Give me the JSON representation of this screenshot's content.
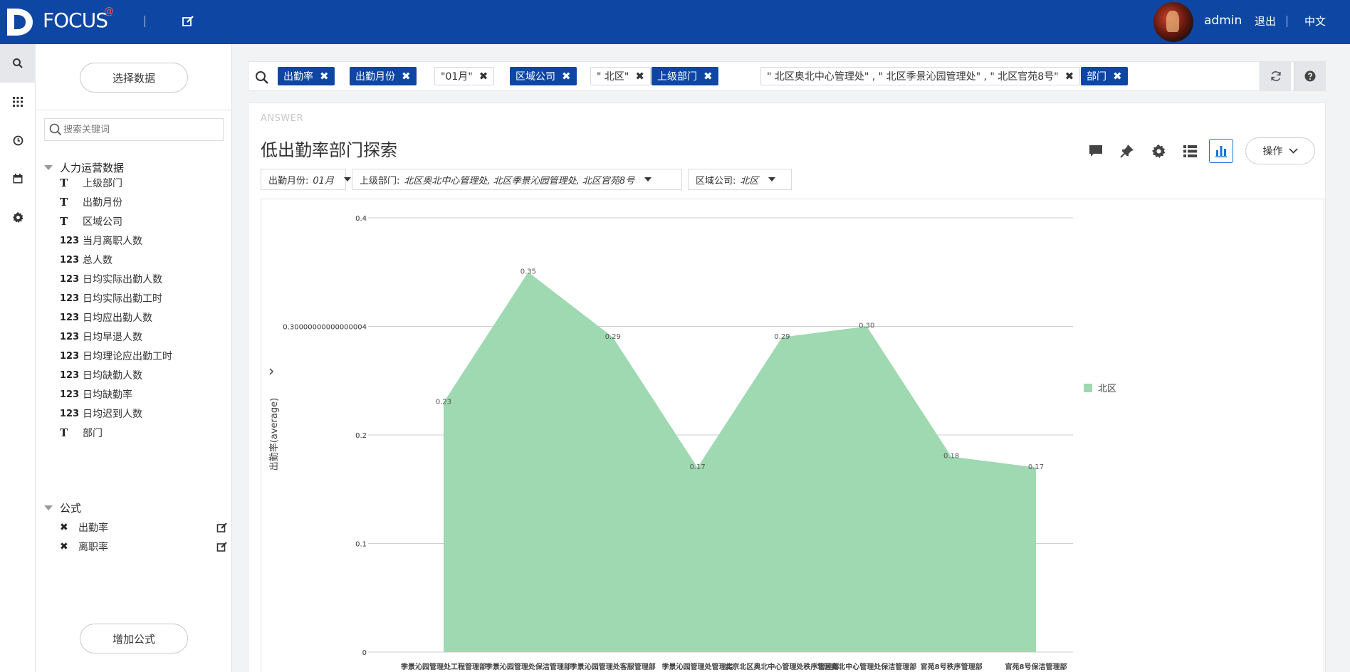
{
  "header": {
    "logo_text": "FOCUS",
    "logo_mark": "@",
    "user": "admin",
    "logout": "退出",
    "language": "中文"
  },
  "rail": {
    "items": [
      {
        "icon": "search-icon",
        "active": true
      },
      {
        "icon": "grid-icon",
        "active": false
      },
      {
        "icon": "clock-icon",
        "active": false
      },
      {
        "icon": "calendar-icon",
        "active": false
      },
      {
        "icon": "gear-icon",
        "active": false
      }
    ]
  },
  "panel": {
    "select_data": "选择数据",
    "search_placeholder": "搜索关键词",
    "group_title": "人力运营数据",
    "fields": [
      {
        "type": "T",
        "name": "上级部门"
      },
      {
        "type": "T",
        "name": "出勤月份"
      },
      {
        "type": "T",
        "name": "区域公司"
      },
      {
        "type": "123",
        "name": "当月离职人数"
      },
      {
        "type": "123",
        "name": "总人数"
      },
      {
        "type": "123",
        "name": "日均实际出勤人数"
      },
      {
        "type": "123",
        "name": "日均实际出勤工时"
      },
      {
        "type": "123",
        "name": "日均应出勤人数"
      },
      {
        "type": "123",
        "name": "日均早退人数"
      },
      {
        "type": "123",
        "name": "日均理论应出勤工时"
      },
      {
        "type": "123",
        "name": "日均缺勤人数"
      },
      {
        "type": "123",
        "name": "日均缺勤率"
      },
      {
        "type": "123",
        "name": "日均迟到人数"
      },
      {
        "type": "T",
        "name": "部门"
      }
    ],
    "formula_title": "公式",
    "formulas": [
      "出勤率",
      "离职率"
    ],
    "add_formula": "增加公式"
  },
  "tags": [
    {
      "label": "出勤率",
      "style": "blue"
    },
    {
      "label": "出勤月份",
      "style": "blue"
    },
    {
      "label": "\"01月\"",
      "style": "plain"
    },
    {
      "label": "区域公司",
      "style": "blue"
    },
    {
      "label": "\" 北区\"",
      "style": "plain"
    },
    {
      "label": "上级部门",
      "style": "blue"
    },
    {
      "label": "\" 北区奥北中心管理处\" , \" 北区季景沁园管理处\" , \" 北区官苑8号\"",
      "style": "plain"
    },
    {
      "label": "部门",
      "style": "blue"
    }
  ],
  "answer": {
    "label": "ANSWER",
    "title": "低出勤率部门探索",
    "ops": "操作",
    "filters": [
      {
        "key": "出勤月份:",
        "value": "01月"
      },
      {
        "key": "上级部门:",
        "value": "北区奥北中心管理处, 北区季景沁园管理处, 北区官苑8号"
      },
      {
        "key": "区域公司:",
        "value": "北区"
      }
    ]
  },
  "chart_data": {
    "type": "area",
    "ylabel": "出勤率(average)",
    "ylim": [
      0,
      0.4
    ],
    "yticks": [
      "0",
      "0.1",
      "0.2",
      "0.30000000000000004",
      "0.4"
    ],
    "grid": true,
    "legend_position": "right",
    "color": "#9ed9b1",
    "categories": [
      "季景沁园管理处工程管理部",
      "季景沁园管理处保洁管理部",
      "季景沁园管理处客服管理部",
      "季景沁园管理处管理类",
      "北京北区奥北中心管理处秩序管理部",
      "北区奥北中心管理处保洁管理部",
      "官苑8号秩序管理部",
      "官苑8号保洁管理部"
    ],
    "series": [
      {
        "name": "北区",
        "values": [
          0.23,
          0.35,
          0.29,
          0.17,
          0.29,
          0.3,
          0.18,
          0.17
        ],
        "labels": [
          "0.23",
          "0.35",
          "0.29",
          "0.17",
          "0.29",
          "0.30",
          "0.18",
          "0.17"
        ]
      }
    ]
  }
}
